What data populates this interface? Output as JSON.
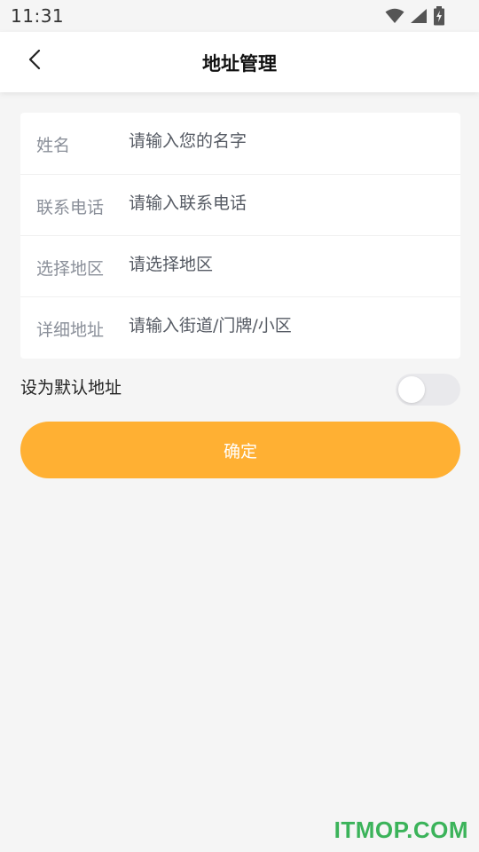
{
  "status_bar": {
    "time": "11:31",
    "icons": [
      "wifi-icon",
      "signal-icon",
      "battery-charging-icon"
    ]
  },
  "header": {
    "back_icon": "chevron-left-icon",
    "title": "地址管理"
  },
  "form": {
    "rows": [
      {
        "label": "姓名",
        "placeholder": "请输入您的名字",
        "value": ""
      },
      {
        "label": "联系电话",
        "placeholder": "请输入联系电话",
        "value": ""
      },
      {
        "label": "选择地区",
        "placeholder": "请选择地区",
        "value": ""
      },
      {
        "label": "详细地址",
        "placeholder": "请输入街道/门牌/小区",
        "value": ""
      }
    ]
  },
  "default_address": {
    "label": "设为默认地址",
    "enabled": false
  },
  "confirm_button": {
    "label": "确定"
  },
  "colors": {
    "accent": "#ffb033",
    "background": "#f5f5f5",
    "label": "#8a8f99",
    "watermark": "#3bb35a"
  },
  "watermark": {
    "text": "ITMOP.COM"
  }
}
